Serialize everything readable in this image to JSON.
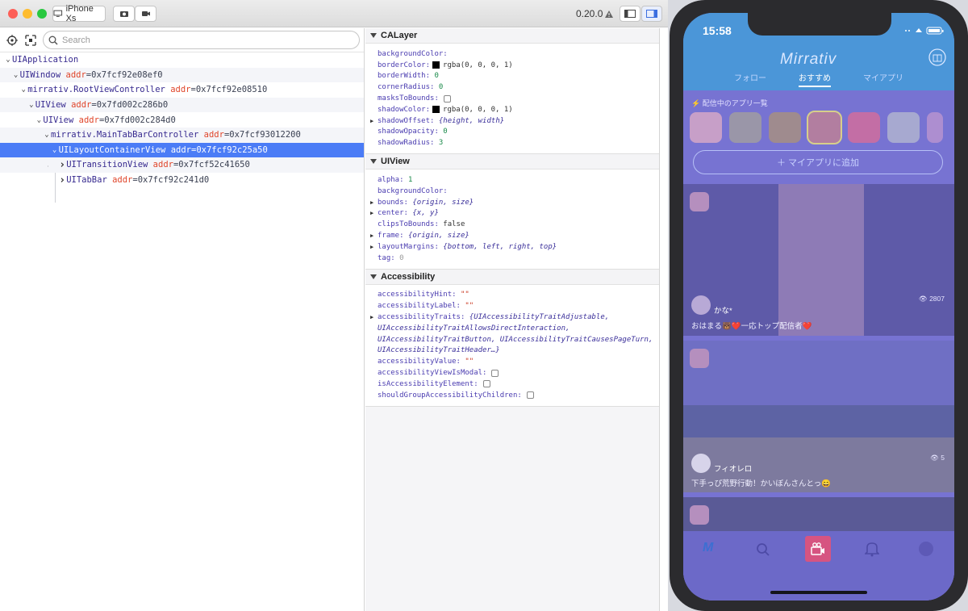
{
  "toolbar": {
    "device_label": "iPhone Xs",
    "version": "0.20.0",
    "colors": {
      "close": "#fd5f57",
      "minimize": "#febc2e",
      "zoom": "#29c840",
      "selection": "#4b7cf6"
    }
  },
  "search": {
    "placeholder": "Search",
    "value": ""
  },
  "tree": [
    {
      "name": "UIApplication",
      "addr": "",
      "depth": 0,
      "expanded": true
    },
    {
      "name": "UIWindow",
      "addr": "0x7fcf92e08ef0",
      "depth": 1,
      "expanded": true
    },
    {
      "name": "mirrativ.RootViewController",
      "addr": "0x7fcf92e08510",
      "depth": 2,
      "expanded": true
    },
    {
      "name": "UIView",
      "addr": "0x7fd002c286b0",
      "depth": 3,
      "expanded": true
    },
    {
      "name": "UIView",
      "addr": "0x7fd002c284d0",
      "depth": 4,
      "expanded": true
    },
    {
      "name": "mirrativ.MainTabBarController",
      "addr": "0x7fcf93012200",
      "depth": 5,
      "expanded": true
    },
    {
      "name": "UILayoutContainerView",
      "addr": "0x7fcf92c25a50",
      "depth": 6,
      "expanded": true,
      "selected": true
    },
    {
      "name": "UITransitionView",
      "addr": "0x7fcf52c41650",
      "depth": 7,
      "expanded": false
    },
    {
      "name": "UITabBar",
      "addr": "0x7fcf92c241d0",
      "depth": 7,
      "expanded": false
    }
  ],
  "addr_key": "addr",
  "calayer": {
    "title": "CALayer",
    "backgroundColor_key": "backgroundColor:",
    "borderColor_key": "borderColor:",
    "borderColor_val": "rgba(0, 0, 0, 1)",
    "borderWidth_key": "borderWidth:",
    "borderWidth_val": "0",
    "cornerRadius_key": "cornerRadius:",
    "cornerRadius_val": "0",
    "masksToBounds_key": "masksToBounds:",
    "shadowColor_key": "shadowColor:",
    "shadowColor_val": "rgba(0, 0, 0, 1)",
    "shadowOffset_key": "shadowOffset:",
    "shadowOffset_val": "{height, width}",
    "shadowOpacity_key": "shadowOpacity:",
    "shadowOpacity_val": "0",
    "shadowRadius_key": "shadowRadius:",
    "shadowRadius_val": "3"
  },
  "uiview": {
    "title": "UIView",
    "alpha_key": "alpha:",
    "alpha_val": "1",
    "backgroundColor_key": "backgroundColor:",
    "bounds_key": "bounds:",
    "bounds_val": "{origin, size}",
    "center_key": "center:",
    "center_val": "{x, y}",
    "clipsToBounds_key": "clipsToBounds:",
    "clipsToBounds_val": "false",
    "frame_key": "frame:",
    "frame_val": "{origin, size}",
    "layoutMargins_key": "layoutMargins:",
    "layoutMargins_val": "{bottom, left, right, top}",
    "tag_key": "tag:",
    "tag_val": "0"
  },
  "accessibility": {
    "title": "Accessibility",
    "hint_key": "accessibilityHint:",
    "hint_val": "\"\"",
    "label_key": "accessibilityLabel:",
    "label_val": "\"\"",
    "traits_key": "accessibilityTraits:",
    "traits_line1": "{UIAccessibilityTraitAdjustable,",
    "traits_line2": "UIAccessibilityTraitAllowsDirectInteraction,",
    "traits_line3": "UIAccessibilityTraitButton, UIAccessibilityTraitCausesPageTurn,",
    "traits_line4": "UIAccessibilityTraitHeader…}",
    "value_key": "accessibilityValue:",
    "value_val": "\"\"",
    "viewIsModal_key": "accessibilityViewIsModal:",
    "isElement_key": "isAccessibilityElement:",
    "groupChildren_key": "shouldGroupAccessibilityChildren:"
  },
  "phone": {
    "time": "15:58",
    "app_title": "Mirrativ",
    "tabs": [
      "フォロー",
      "おすすめ",
      "マイアプリ"
    ],
    "active_tab": "おすすめ",
    "apps_label": "配信中のアプリ一覧",
    "add_button": "マイアプリに追加",
    "card1_user": "かな*",
    "card1_views": "2807",
    "card1_caption": "おはまる🐻❤️一応トップ配信者❤️",
    "card2_user": "フィオレロ",
    "card2_views": "5",
    "card2_caption": "下手っぴ荒野行動！かいぼんさんとっ😄"
  }
}
